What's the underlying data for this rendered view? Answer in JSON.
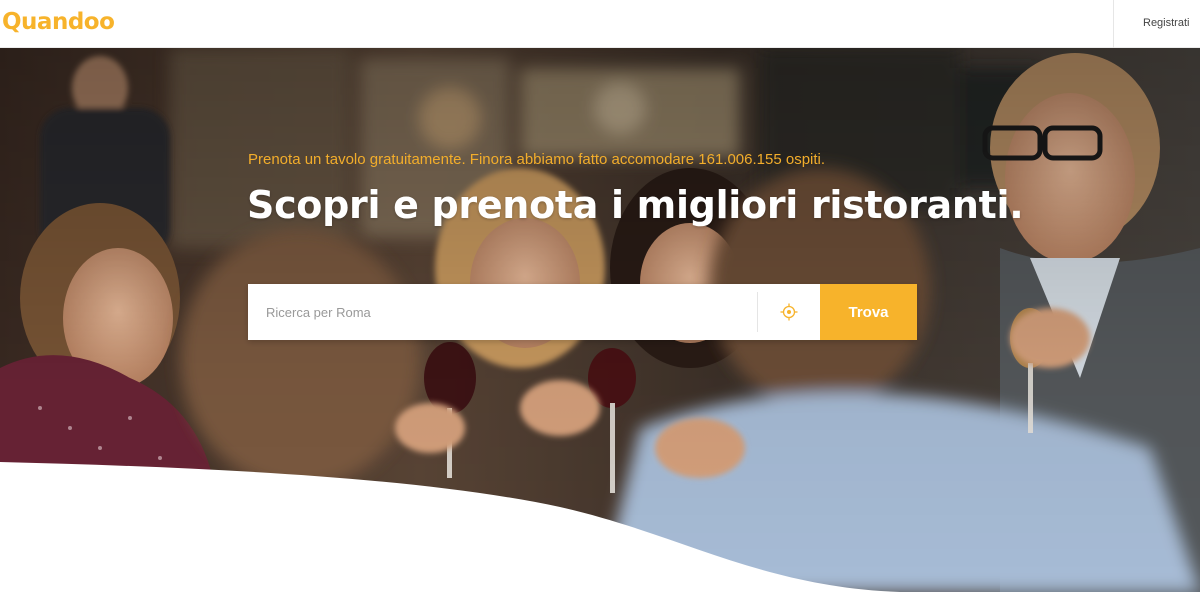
{
  "brand": {
    "name": "Quandoo",
    "color": "#f7b32b"
  },
  "header": {
    "register_label": "Registrati"
  },
  "hero": {
    "tagline": "Prenota un tavolo gratuitamente. Finora abbiamo fatto accomodare 161.006.155 ospiti.",
    "headline": "Scopri e prenota i migliori ristoranti.",
    "tagline_color": "#f2ad2b",
    "headline_color": "#ffffff",
    "photo_description_icon": "restaurant-toast-photo"
  },
  "search": {
    "placeholder": "Ricerca per Roma",
    "value": "",
    "locate_icon": "crosshair-icon",
    "button_label": "Trova",
    "button_color": "#f7b32b"
  }
}
